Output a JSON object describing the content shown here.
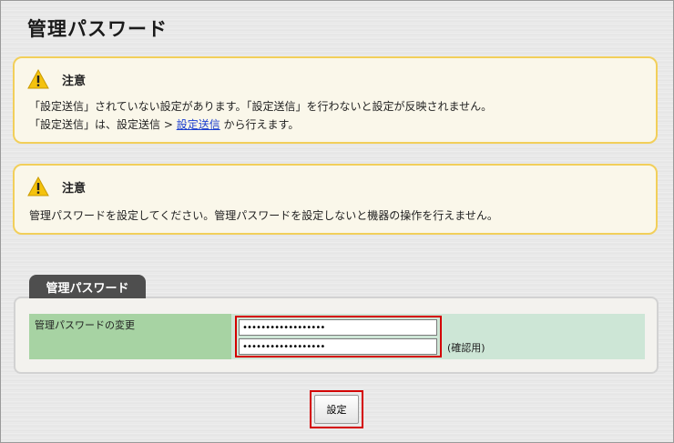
{
  "page": {
    "title": "管理パスワード"
  },
  "notices": [
    {
      "title": "注意",
      "lines": [
        "「設定送信」されていない設定があります。「設定送信」を行わないと設定が反映されません。"
      ],
      "line2_prefix": "「設定送信」は、設定送信 > ",
      "line2_link": "設定送信",
      "line2_suffix": " から行えます。"
    },
    {
      "title": "注意",
      "lines": [
        "管理パスワードを設定してください。管理パスワードを設定しないと機器の操作を行えません。"
      ]
    }
  ],
  "section": {
    "tab_label": "管理パスワード",
    "row_label": "管理パスワードの変更",
    "password_value": "••••••••••••••••••",
    "confirm_value": "••••••••••••••••••",
    "confirm_label": "(確認用)"
  },
  "buttons": {
    "set_label": "設定"
  },
  "colors": {
    "notice_border": "#f2cf5a",
    "notice_bg": "#faf7ea",
    "highlight_red": "#d40000",
    "label_green": "#a7d3a3",
    "value_green": "#cde6d6",
    "tab_dark": "#4e4e4e"
  },
  "icons": {
    "warning": "warning-triangle-icon"
  }
}
